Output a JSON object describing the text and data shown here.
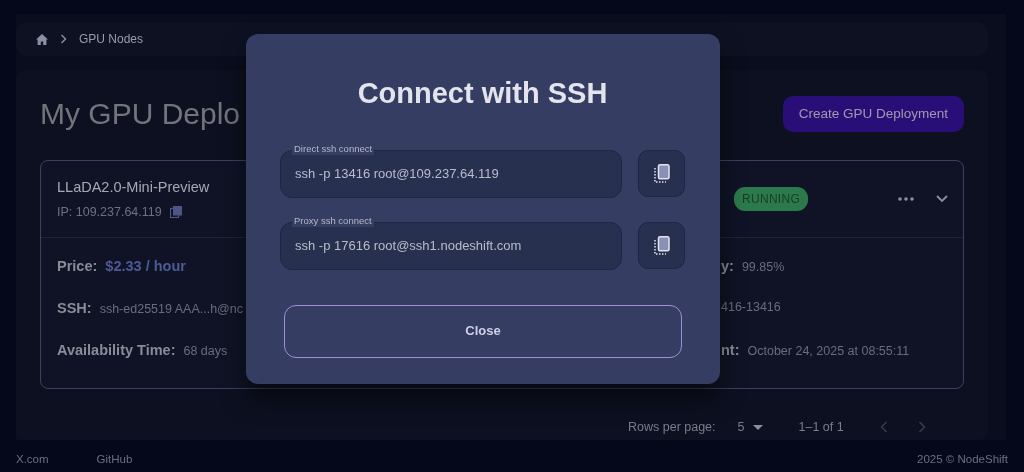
{
  "breadcrumb": {
    "current": "GPU Nodes"
  },
  "page": {
    "title": "My GPU Deplo",
    "create_button": "Create GPU Deployment"
  },
  "deployment": {
    "name": "LLaDA2.0-Mini-Preview",
    "ip": "IP: 109.237.64.119",
    "status": "RUNNING",
    "details_left": [
      {
        "kind": "price",
        "label": "Price:",
        "value": "$2.33 / hour"
      },
      {
        "kind": "text",
        "label": "SSH:",
        "value": "ssh-ed25519 AAA...h@nc"
      },
      {
        "kind": "text",
        "label": "Availability Time:",
        "value": "68 days"
      }
    ],
    "details_right": [
      {
        "label": "y:",
        "value": "99.85%"
      },
      {
        "value": "416-13416"
      },
      {
        "label": "nt:",
        "value": "October 24, 2025 at 08:55:11"
      }
    ]
  },
  "pagination": {
    "rows_label": "Rows per page:",
    "rows_value": "5",
    "range": "1–1 of 1"
  },
  "footer": {
    "links": [
      "X.com",
      "GitHub"
    ],
    "copyright": "2025 © NodeShift"
  },
  "modal": {
    "title": "Connect with SSH",
    "fields": [
      {
        "label": "Direct ssh connect",
        "value": "ssh -p 13416 root@109.237.64.119"
      },
      {
        "label": "Proxy ssh connect",
        "value": "ssh -p 17616 root@ssh1.nodeshift.com"
      }
    ],
    "close_button": "Close"
  }
}
